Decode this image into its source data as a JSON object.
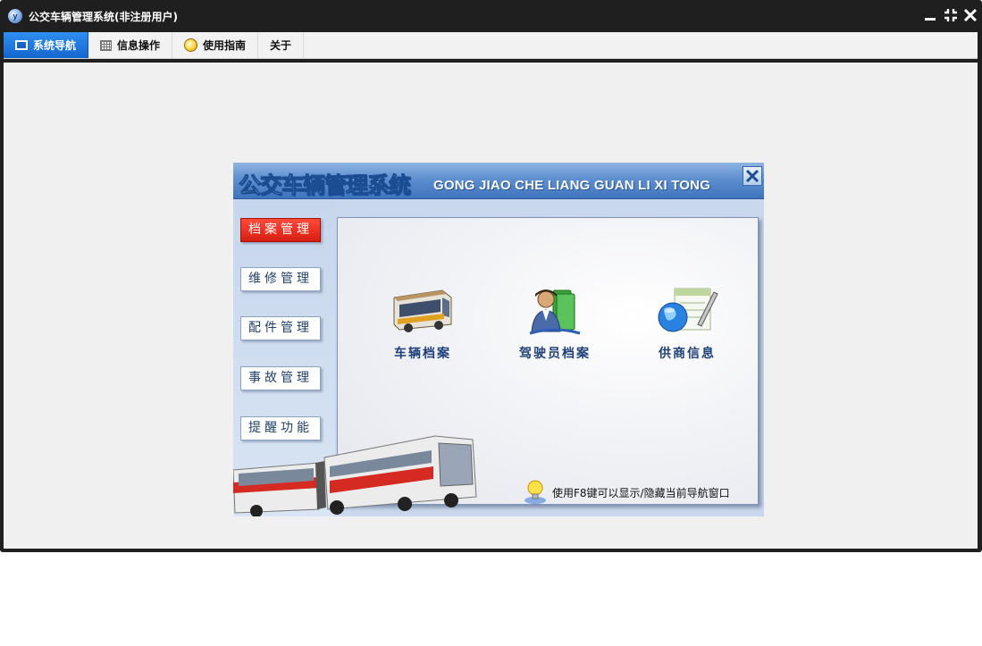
{
  "window": {
    "title": "公交车辆管理系统(非注册用户)",
    "logo_letter": "y"
  },
  "menu": {
    "tabs": [
      {
        "label": "系统导航",
        "icon": "monitor-icon",
        "active": true
      },
      {
        "label": "信息操作",
        "icon": "grid-icon",
        "active": false
      },
      {
        "label": "使用指南",
        "icon": "lightbulb-icon",
        "active": false
      },
      {
        "label": "关于",
        "icon": "",
        "active": false
      }
    ]
  },
  "nav_dialog": {
    "title": "公交车辆管理系统",
    "pinyin": "GONG JIAO CHE LIANG GUAN LI XI TONG",
    "side_buttons": [
      {
        "label": "档案管理",
        "active": true
      },
      {
        "label": "维修管理",
        "active": false
      },
      {
        "label": "配件管理",
        "active": false
      },
      {
        "label": "事故管理",
        "active": false
      },
      {
        "label": "提醒功能",
        "active": false
      }
    ],
    "items": [
      {
        "label": "车辆档案",
        "icon": "bus-icon"
      },
      {
        "label": "驾驶员档案",
        "icon": "driver-icon"
      },
      {
        "label": "供商信息",
        "icon": "globe-document-icon"
      }
    ],
    "hint": "使用F8键可以显示/隐藏当前导航窗口"
  },
  "colors": {
    "titlebar": "#1f1f1f",
    "active_tab": "#1466cf",
    "active_side_button": "#d81d10",
    "nav_header": "#3f74bd"
  }
}
